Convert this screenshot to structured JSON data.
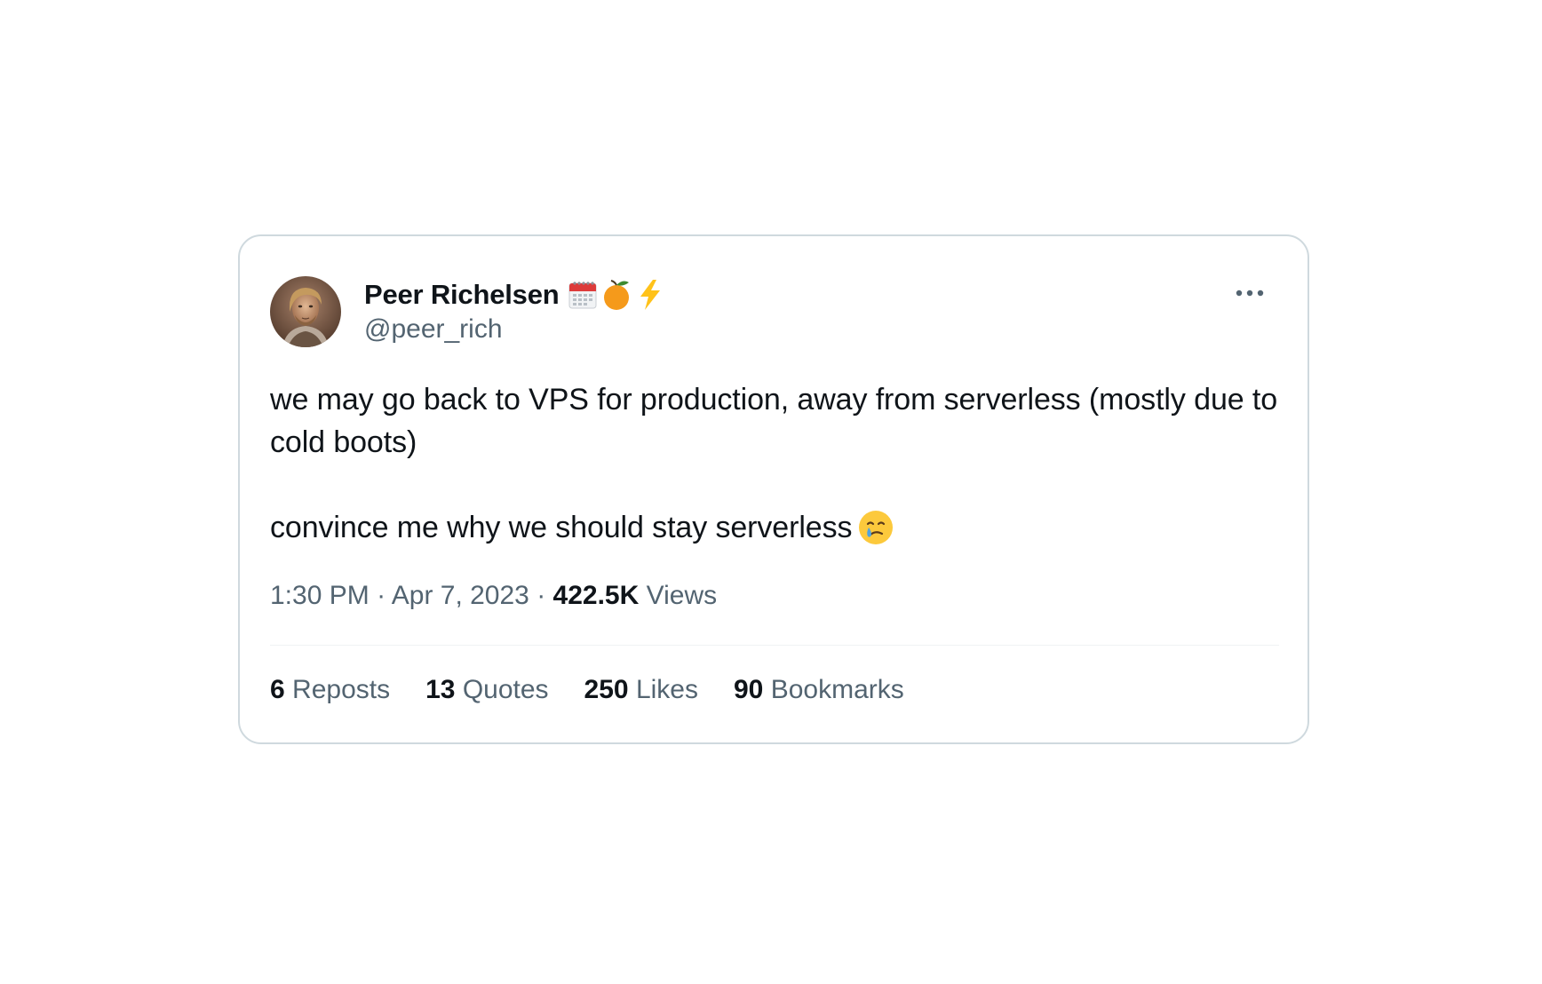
{
  "tweet": {
    "author": {
      "name": "Peer Richelsen",
      "handle": "@peer_rich",
      "name_badges": [
        "calendar-emoji",
        "tangerine-emoji",
        "high-voltage-emoji"
      ]
    },
    "more_icon": "ellipsis-horizontal-icon",
    "text": {
      "paragraph1": "we may go back to VPS for production, away from serverless (mostly due to cold boots)",
      "paragraph2": "convince me why we should stay serverless",
      "paragraph2_emoji": "face-holding-back-tears-emoji"
    },
    "meta": {
      "time": "1:30 PM",
      "separator": " · ",
      "date": "Apr 7, 2023",
      "views_count": "422.5K",
      "views_label": "Views"
    },
    "stats": {
      "reposts": {
        "count": "6",
        "label": "Reposts"
      },
      "quotes": {
        "count": "13",
        "label": "Quotes"
      },
      "likes": {
        "count": "250",
        "label": "Likes"
      },
      "bookmarks": {
        "count": "90",
        "label": "Bookmarks"
      }
    },
    "colors": {
      "text_primary": "#0f1419",
      "text_secondary": "#536471",
      "border": "#cfd9de",
      "divider": "#eff3f4"
    }
  }
}
